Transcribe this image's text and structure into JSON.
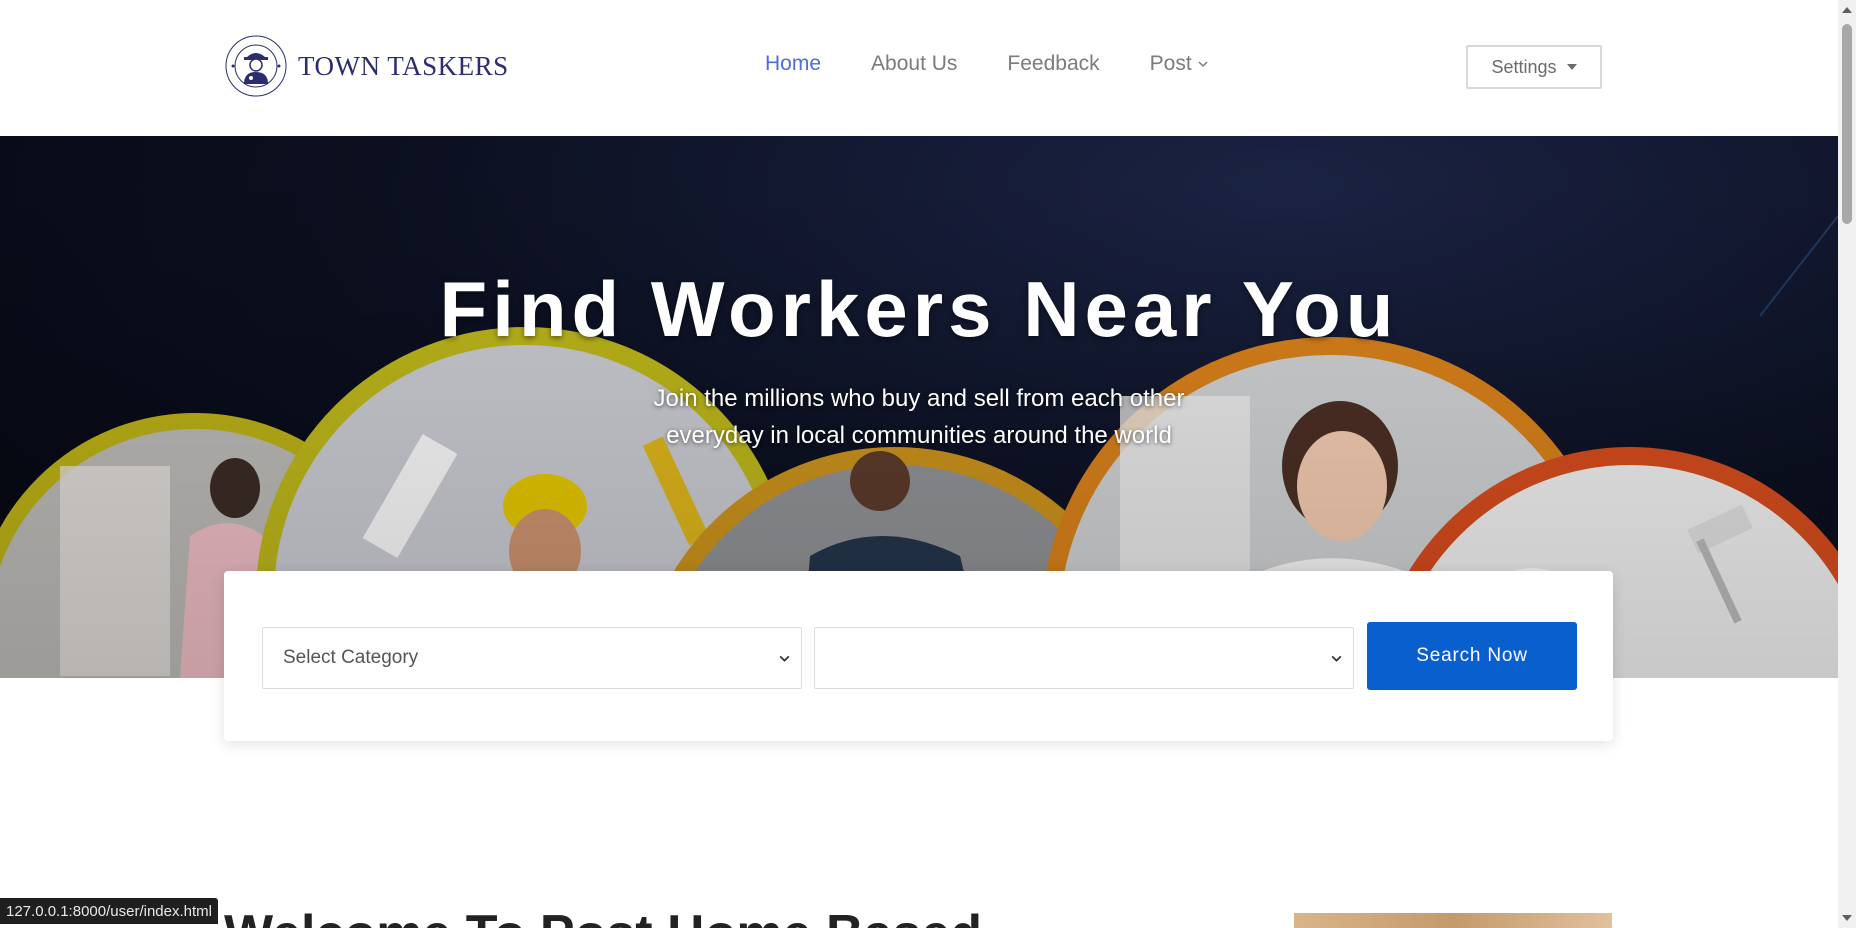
{
  "brand": {
    "name": "TOWN TASKERS",
    "emblem_text": "TOWN TASKERS"
  },
  "nav": {
    "items": [
      {
        "label": "Home",
        "active": true
      },
      {
        "label": "About Us",
        "active": false
      },
      {
        "label": "Feedback",
        "active": false
      },
      {
        "label": "Post",
        "active": false,
        "has_dropdown": true
      }
    ]
  },
  "settings": {
    "label": "Settings"
  },
  "hero": {
    "title": "Find Workers Near You",
    "subtitle_line1": "Join the millions who buy and sell from each other",
    "subtitle_line2": "everyday in local communities around the world"
  },
  "search": {
    "category_selected": "Select Category",
    "location_selected": "",
    "button_label": "Search Now"
  },
  "welcome": {
    "heading": "Welcome To Post Home Based"
  },
  "status_bar": {
    "url": "127.0.0.1:8000/user/index.html"
  },
  "colors": {
    "accent": "#0a5fcf",
    "nav_active": "#4a6fd8",
    "brand": "#2b2d6e",
    "hero_bg": "#0b0f1f"
  },
  "icons": [
    "logo-emblem-icon",
    "chevron-down-icon",
    "caret-down-icon"
  ]
}
